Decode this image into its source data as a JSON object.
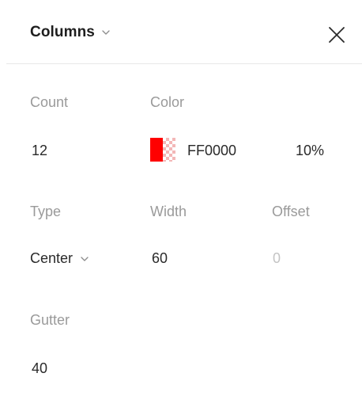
{
  "header": {
    "title": "Columns",
    "title_chevron_icon": "chevron-down-icon",
    "close_icon": "close-icon"
  },
  "fields": {
    "count": {
      "label": "Count",
      "value": "12"
    },
    "color": {
      "label": "Color",
      "hex": "FF0000",
      "opacity": "10%",
      "swatch_color": "#ff0000"
    },
    "type": {
      "label": "Type",
      "value": "Center",
      "chevron_icon": "chevron-down-icon"
    },
    "width": {
      "label": "Width",
      "value": "60"
    },
    "offset": {
      "label": "Offset",
      "value": "0"
    },
    "gutter": {
      "label": "Gutter",
      "value": "40"
    }
  }
}
